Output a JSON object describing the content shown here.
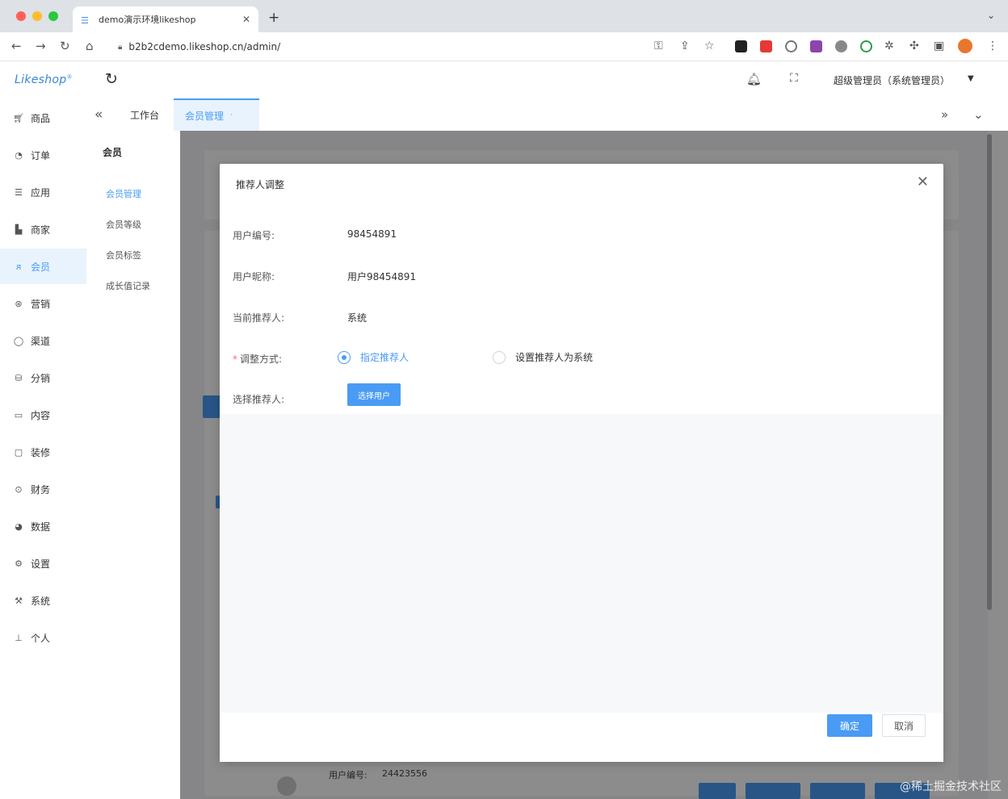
{
  "browser": {
    "tab_title": "demo演示环境likeshop",
    "url": "b2b2cdemo.likeshop.cn/admin/"
  },
  "header": {
    "logo": "Likeshop",
    "user_name": "超级管理员（系统管理员）"
  },
  "sidebar": {
    "items": [
      {
        "label": "商品",
        "icon": "cart-icon"
      },
      {
        "label": "订单",
        "icon": "bell-icon"
      },
      {
        "label": "应用",
        "icon": "list-icon"
      },
      {
        "label": "商家",
        "icon": "chart-icon"
      },
      {
        "label": "会员",
        "icon": "user-icon"
      },
      {
        "label": "营销",
        "icon": "gift-icon"
      },
      {
        "label": "渠道",
        "icon": "circle-icon"
      },
      {
        "label": "分销",
        "icon": "database-icon"
      },
      {
        "label": "内容",
        "icon": "book-icon"
      },
      {
        "label": "装修",
        "icon": "square-icon"
      },
      {
        "label": "财务",
        "icon": "money-icon"
      },
      {
        "label": "数据",
        "icon": "pie-icon"
      },
      {
        "label": "设置",
        "icon": "gear-icon"
      },
      {
        "label": "系统",
        "icon": "tool-icon"
      },
      {
        "label": "个人",
        "icon": "person-icon"
      }
    ],
    "active_index": 4
  },
  "subsidebar": {
    "title": "会员",
    "items": [
      "会员管理",
      "会员等级",
      "会员标签",
      "成长值记录"
    ]
  },
  "tabs": {
    "home": "工作台",
    "active": "会员管理"
  },
  "dialog": {
    "title": "推荐人调整",
    "fields": [
      {
        "label": "用户编号:",
        "value": "98454891"
      },
      {
        "label": "用户昵称:",
        "value": "用户98454891"
      },
      {
        "label": "当前推荐人:",
        "value": "系统"
      }
    ],
    "adjust_label": "调整方式:",
    "radio_options": [
      "指定推荐人",
      "设置推荐人为系统"
    ],
    "select_label": "选择推荐人:",
    "select_button": "选择用户",
    "confirm": "确定",
    "cancel": "取消"
  },
  "background": {
    "user_no_label": "用户编号:",
    "user_no_value": "24423556"
  },
  "watermark": "@稀土掘金技术社区",
  "colors": {
    "accent": "#4a9bf4",
    "active_bg": "#e8f3fe"
  }
}
